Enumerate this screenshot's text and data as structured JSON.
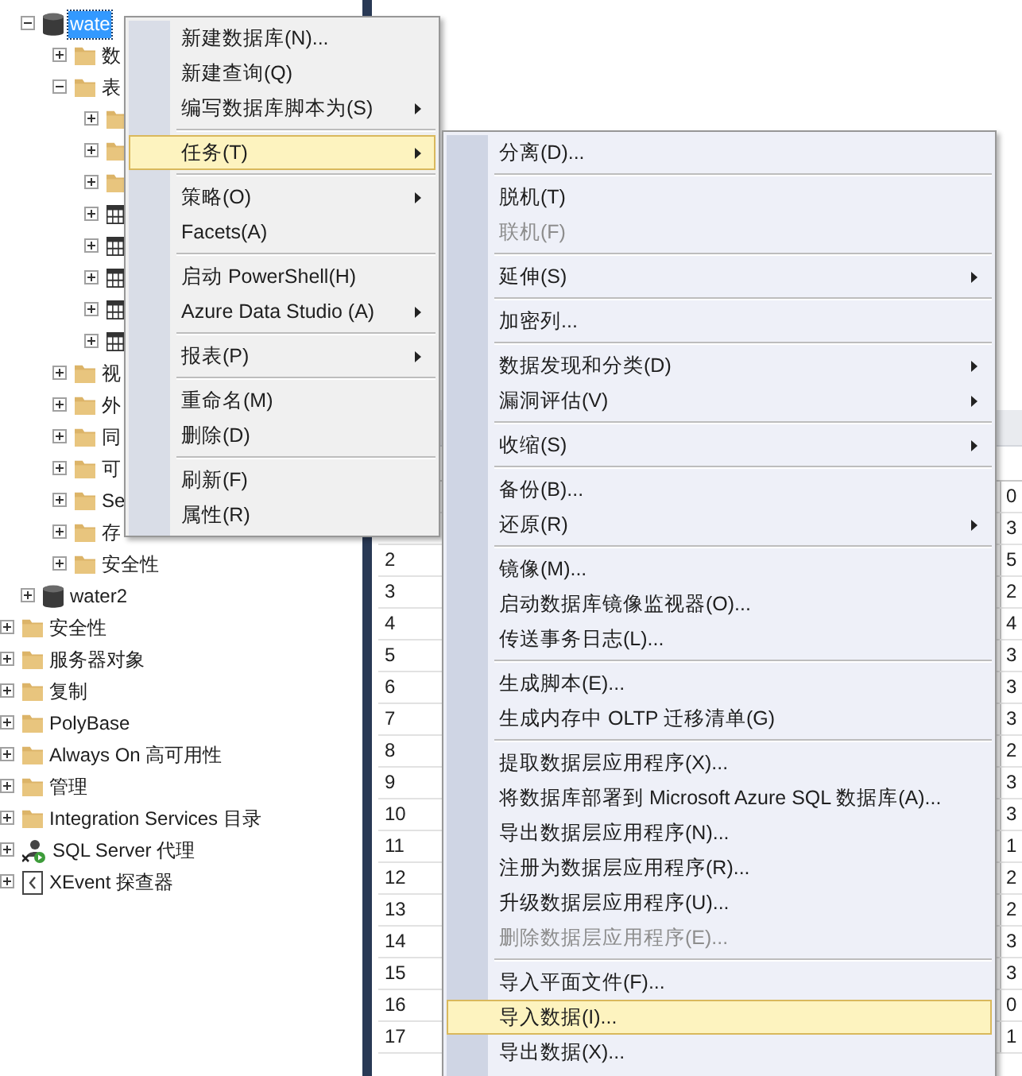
{
  "tree": [
    {
      "kind": "group",
      "children": [
        {
          "kind": "database",
          "label": "wate",
          "expanded": true,
          "selected": true,
          "children": [
            {
              "kind": "folder",
              "label": "数",
              "expanded": false,
              "selected": false
            },
            {
              "kind": "folder",
              "label": "表",
              "expanded": true,
              "selected": false,
              "children": [
                {
                  "kind": "folder",
                  "expanded": false,
                  "selected": false
                },
                {
                  "kind": "folder",
                  "expanded": false,
                  "selected": false
                },
                {
                  "kind": "folder",
                  "expanded": false,
                  "selected": false
                },
                {
                  "kind": "table",
                  "expanded": false,
                  "selected": false
                },
                {
                  "kind": "table",
                  "expanded": false,
                  "selected": false
                },
                {
                  "kind": "table",
                  "expanded": false,
                  "selected": false
                },
                {
                  "kind": "table",
                  "expanded": false,
                  "selected": false
                },
                {
                  "kind": "table",
                  "expanded": false,
                  "selected": false
                }
              ]
            },
            {
              "kind": "folder",
              "label": "视",
              "expanded": false,
              "selected": false
            },
            {
              "kind": "folder",
              "label": "外",
              "expanded": false,
              "selected": false
            },
            {
              "kind": "folder",
              "label": "同",
              "expanded": false,
              "selected": false
            },
            {
              "kind": "folder",
              "label": "可",
              "expanded": false,
              "selected": false
            },
            {
              "kind": "folder",
              "label": "Se",
              "expanded": false,
              "selected": false
            },
            {
              "kind": "folder",
              "label": "存",
              "expanded": false,
              "selected": false
            },
            {
              "kind": "folder",
              "label": "安全性",
              "expanded": false,
              "selected": false
            }
          ]
        },
        {
          "kind": "database",
          "label": "water2",
          "expanded": false,
          "selected": false
        }
      ]
    },
    {
      "kind": "folder",
      "label": "安全性",
      "expanded": false,
      "selected": false
    },
    {
      "kind": "folder",
      "label": "服务器对象",
      "expanded": false,
      "selected": false
    },
    {
      "kind": "folder",
      "label": "复制",
      "expanded": false,
      "selected": false
    },
    {
      "kind": "folder",
      "label": "PolyBase",
      "expanded": false,
      "selected": false
    },
    {
      "kind": "folder",
      "label": "Always On 高可用性",
      "expanded": false,
      "selected": false
    },
    {
      "kind": "folder",
      "label": "管理",
      "expanded": false,
      "selected": false
    },
    {
      "kind": "folder",
      "label": "Integration Services 目录",
      "expanded": false,
      "selected": false
    },
    {
      "kind": "agent",
      "label": "SQL Server 代理",
      "expanded": false,
      "selected": false
    },
    {
      "kind": "xevent",
      "label": "XEvent 探查器",
      "expanded": false,
      "selected": false
    }
  ],
  "grid": {
    "rows": [
      {
        "value": "0"
      },
      {
        "value": "3"
      },
      {
        "number": "2",
        "value": "5"
      },
      {
        "number": "3",
        "value": "2"
      },
      {
        "number": "4",
        "value": "4"
      },
      {
        "number": "5",
        "value": "3"
      },
      {
        "number": "6",
        "value": "3"
      },
      {
        "number": "7",
        "value": "3"
      },
      {
        "number": "8",
        "value": "2"
      },
      {
        "number": "9",
        "value": "3"
      },
      {
        "number": "10",
        "value": "3"
      },
      {
        "number": "11",
        "value": "1"
      },
      {
        "number": "12",
        "value": "2"
      },
      {
        "number": "13",
        "value": "2"
      },
      {
        "number": "14",
        "value": "3"
      },
      {
        "number": "15",
        "value": "3"
      },
      {
        "number": "16",
        "value": "0"
      },
      {
        "number": "17",
        "value": "1"
      }
    ]
  },
  "context_menu": {
    "items": [
      {
        "kind": "item",
        "label": "新建数据库(N)...",
        "has_submenu": false,
        "selected": false,
        "disabled": false
      },
      {
        "kind": "item",
        "label": "新建查询(Q)",
        "has_submenu": false,
        "selected": false,
        "disabled": false
      },
      {
        "kind": "item",
        "label": "编写数据库脚本为(S)",
        "has_submenu": true,
        "selected": false,
        "disabled": false
      },
      {
        "kind": "separator"
      },
      {
        "kind": "item",
        "label": "任务(T)",
        "has_submenu": true,
        "selected": true,
        "disabled": false
      },
      {
        "kind": "separator"
      },
      {
        "kind": "item",
        "label": "策略(O)",
        "has_submenu": true,
        "selected": false,
        "disabled": false
      },
      {
        "kind": "item",
        "label": "Facets(A)",
        "has_submenu": false,
        "selected": false,
        "disabled": false
      },
      {
        "kind": "separator"
      },
      {
        "kind": "item",
        "label": "启动 PowerShell(H)",
        "has_submenu": false,
        "selected": false,
        "disabled": false
      },
      {
        "kind": "item",
        "label": "Azure Data Studio (A)",
        "has_submenu": true,
        "selected": false,
        "disabled": false
      },
      {
        "kind": "separator"
      },
      {
        "kind": "item",
        "label": "报表(P)",
        "has_submenu": true,
        "selected": false,
        "disabled": false
      },
      {
        "kind": "separator"
      },
      {
        "kind": "item",
        "label": "重命名(M)",
        "has_submenu": false,
        "selected": false,
        "disabled": false
      },
      {
        "kind": "item",
        "label": "删除(D)",
        "has_submenu": false,
        "selected": false,
        "disabled": false
      },
      {
        "kind": "separator"
      },
      {
        "kind": "item",
        "label": "刷新(F)",
        "has_submenu": false,
        "selected": false,
        "disabled": false
      },
      {
        "kind": "item",
        "label": "属性(R)",
        "has_submenu": false,
        "selected": false,
        "disabled": false
      }
    ]
  },
  "submenu": {
    "items": [
      {
        "kind": "item",
        "label": "分离(D)...",
        "has_submenu": false,
        "selected": false,
        "disabled": false
      },
      {
        "kind": "separator"
      },
      {
        "kind": "item",
        "label": "脱机(T)",
        "has_submenu": false,
        "selected": false,
        "disabled": false
      },
      {
        "kind": "item",
        "label": "联机(F)",
        "has_submenu": false,
        "selected": false,
        "disabled": true
      },
      {
        "kind": "separator"
      },
      {
        "kind": "item",
        "label": "延伸(S)",
        "has_submenu": true,
        "selected": false,
        "disabled": false
      },
      {
        "kind": "separator"
      },
      {
        "kind": "item",
        "label": "加密列...",
        "has_submenu": false,
        "selected": false,
        "disabled": false
      },
      {
        "kind": "separator"
      },
      {
        "kind": "item",
        "label": "数据发现和分类(D)",
        "has_submenu": true,
        "selected": false,
        "disabled": false
      },
      {
        "kind": "item",
        "label": "漏洞评估(V)",
        "has_submenu": true,
        "selected": false,
        "disabled": false
      },
      {
        "kind": "separator"
      },
      {
        "kind": "item",
        "label": "收缩(S)",
        "has_submenu": true,
        "selected": false,
        "disabled": false
      },
      {
        "kind": "separator"
      },
      {
        "kind": "item",
        "label": "备份(B)...",
        "has_submenu": false,
        "selected": false,
        "disabled": false
      },
      {
        "kind": "item",
        "label": "还原(R)",
        "has_submenu": true,
        "selected": false,
        "disabled": false
      },
      {
        "kind": "separator"
      },
      {
        "kind": "item",
        "label": "镜像(M)...",
        "has_submenu": false,
        "selected": false,
        "disabled": false
      },
      {
        "kind": "item",
        "label": "启动数据库镜像监视器(O)...",
        "has_submenu": false,
        "selected": false,
        "disabled": false
      },
      {
        "kind": "item",
        "label": "传送事务日志(L)...",
        "has_submenu": false,
        "selected": false,
        "disabled": false
      },
      {
        "kind": "separator"
      },
      {
        "kind": "item",
        "label": "生成脚本(E)...",
        "has_submenu": false,
        "selected": false,
        "disabled": false
      },
      {
        "kind": "item",
        "label": "生成内存中 OLTP 迁移清单(G)",
        "has_submenu": false,
        "selected": false,
        "disabled": false
      },
      {
        "kind": "separator"
      },
      {
        "kind": "item",
        "label": "提取数据层应用程序(X)...",
        "has_submenu": false,
        "selected": false,
        "disabled": false
      },
      {
        "kind": "item",
        "label": "将数据库部署到 Microsoft Azure SQL 数据库(A)...",
        "has_submenu": false,
        "selected": false,
        "disabled": false
      },
      {
        "kind": "item",
        "label": "导出数据层应用程序(N)...",
        "has_submenu": false,
        "selected": false,
        "disabled": false
      },
      {
        "kind": "item",
        "label": "注册为数据层应用程序(R)...",
        "has_submenu": false,
        "selected": false,
        "disabled": false
      },
      {
        "kind": "item",
        "label": "升级数据层应用程序(U)...",
        "has_submenu": false,
        "selected": false,
        "disabled": false
      },
      {
        "kind": "item",
        "label": "删除数据层应用程序(E)...",
        "has_submenu": false,
        "selected": false,
        "disabled": true
      },
      {
        "kind": "separator"
      },
      {
        "kind": "item",
        "label": "导入平面文件(F)...",
        "has_submenu": false,
        "selected": false,
        "disabled": false
      },
      {
        "kind": "item",
        "label": "导入数据(I)...",
        "has_submenu": false,
        "selected": true,
        "disabled": false
      },
      {
        "kind": "item",
        "label": "导出数据(X)...",
        "has_submenu": false,
        "selected": false,
        "disabled": false
      }
    ]
  }
}
